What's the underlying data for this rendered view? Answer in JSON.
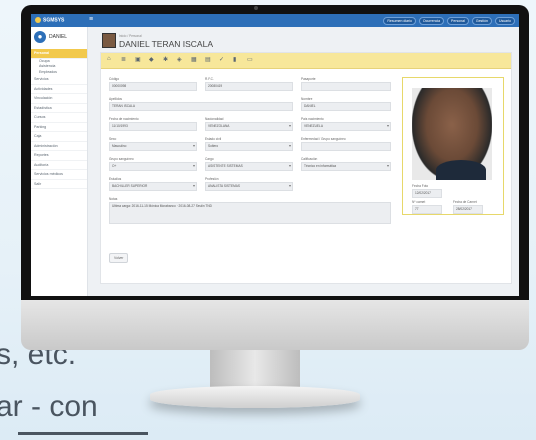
{
  "background": {
    "line1": "s, etc.",
    "line2": "ar - con"
  },
  "app": {
    "logo": "SGMSYS",
    "menu_icon": "hamburger-icon"
  },
  "top_buttons": [
    "Resumen diario",
    "Ocurrencia",
    "Personal",
    "Gestión",
    "Usuario"
  ],
  "user": {
    "name": "DANIEL"
  },
  "sidebar": {
    "items": [
      {
        "label": "Personal",
        "active": true
      },
      {
        "label": "Ocupa",
        "sub": true
      },
      {
        "label": "Asistencia",
        "sub": true
      },
      {
        "label": "Empleados",
        "sub": true
      },
      {
        "label": "Servicios"
      },
      {
        "label": "Actividades"
      },
      {
        "label": "Vinculación"
      },
      {
        "label": "Estadística"
      },
      {
        "label": "Cursos"
      },
      {
        "label": "Parking"
      },
      {
        "label": "Caja"
      },
      {
        "label": "Administración"
      },
      {
        "label": "Reportes"
      },
      {
        "label": "Auditoría"
      },
      {
        "label": "Servicios médicos"
      },
      {
        "label": "Salir"
      }
    ]
  },
  "page": {
    "crumb": "Inicio / Personal",
    "title": "DANIEL TERAN ISCALA"
  },
  "form": {
    "codigo": {
      "label": "Código",
      "value": "00000098"
    },
    "rfc": {
      "label": "R.F.C.",
      "value": "20080419"
    },
    "pasaporte": {
      "label": "Pasaporte",
      "value": ""
    },
    "apellidos": {
      "label": "Apellidos",
      "value": "TERAN ISCALA"
    },
    "nombre": {
      "label": "Nombre",
      "value": "DANIEL"
    },
    "fecha_nac": {
      "label": "Fecha de nacimiento",
      "value": "11/10/1993"
    },
    "nacionalidad": {
      "label": "Nacionalidad",
      "value": "VENEZOLANA"
    },
    "pais_nac": {
      "label": "País nacimiento",
      "value": "VENEZUELA"
    },
    "sexo": {
      "label": "Sexo",
      "value": "Masculino"
    },
    "estado_civil": {
      "label": "Estado civil",
      "value": "Soltero"
    },
    "enfermedad": {
      "label": "Enfermedad / Grupo sanguíneo",
      "value": ""
    },
    "grupo_sanguineo": {
      "label": "Grupo sanguíneo",
      "value": "O+"
    },
    "cargo": {
      "label": "Cargo",
      "value": "ASISTENTE SISTEMAS"
    },
    "calificacion": {
      "label": "Calificación",
      "value": "Técnico en informática"
    },
    "estudios": {
      "label": "Estudios",
      "value": "BACHILLER SUPERIOR"
    },
    "profesion": {
      "label": "Profesión",
      "value": "ANALISTA SISTEMAS"
    },
    "notas": {
      "label": "Notas",
      "value": "Ultima carga: 2016-11-15 Mónica Morabanco · 2016-08-27 Seulin TND"
    },
    "fecha_foto": {
      "label": "Fecha Foto",
      "value": "12/02/2017"
    },
    "n_carnet": {
      "label": "Nº carnet",
      "value": "77"
    },
    "fecha_carnet": {
      "label": "Fecha de Carnet",
      "value": "28/02/2017"
    }
  },
  "buttons": {
    "back": "Volver"
  },
  "toolbar_icons": [
    "home-icon",
    "list-icon",
    "briefcase-icon",
    "car-icon",
    "star-icon",
    "shield-icon",
    "calendar-icon",
    "doc-icon",
    "check-icon",
    "file-icon",
    "grid-icon"
  ]
}
